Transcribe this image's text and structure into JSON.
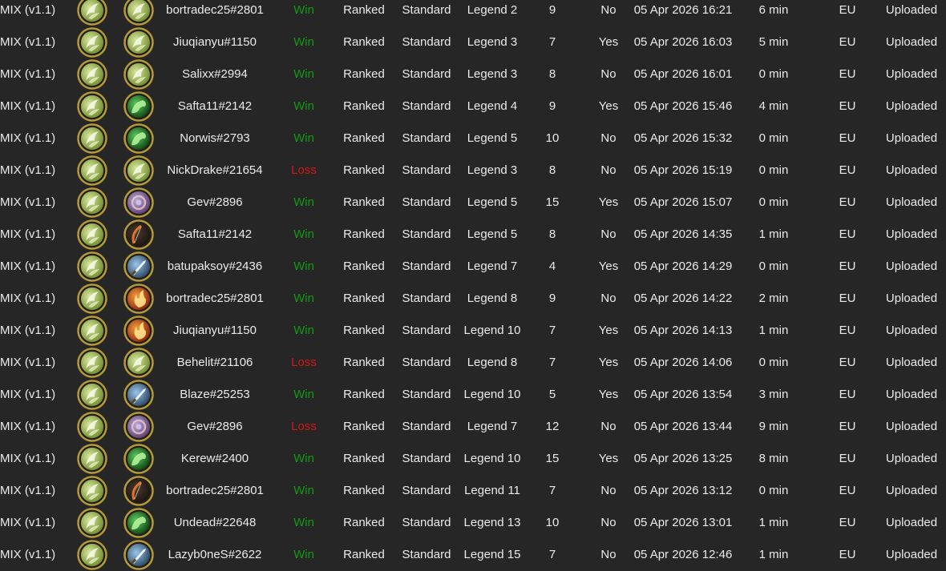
{
  "colors": {
    "background": "#262626",
    "text": "#ebebeb",
    "win": "#139613",
    "loss": "#d21717",
    "frame_gold": "#b59a3a"
  },
  "rows": [
    {
      "deck": "MIX (v1.1)",
      "player_icon": "druid-hero-icon",
      "opponent_icon": "druid-hero-icon",
      "opponent": "bortradec25#2801",
      "result": "Win",
      "mode": "Ranked",
      "format": "Standard",
      "rank": "Legend 2",
      "turns": "9",
      "coin": "No",
      "time": "05 Apr 2026 16:21",
      "duration": "6 min",
      "region": "EU",
      "status": "Uploaded"
    },
    {
      "deck": "MIX (v1.1)",
      "player_icon": "druid-hero-icon",
      "opponent_icon": "druid-hero-icon",
      "opponent": "Jiuqianyu#1150",
      "result": "Win",
      "mode": "Ranked",
      "format": "Standard",
      "rank": "Legend 3",
      "turns": "7",
      "coin": "Yes",
      "time": "05 Apr 2026 16:03",
      "duration": "5 min",
      "region": "EU",
      "status": "Uploaded"
    },
    {
      "deck": "MIX (v1.1)",
      "player_icon": "druid-hero-icon",
      "opponent_icon": "druid-hero-icon",
      "opponent": "Salixx#2994",
      "result": "Win",
      "mode": "Ranked",
      "format": "Standard",
      "rank": "Legend 3",
      "turns": "8",
      "coin": "No",
      "time": "05 Apr 2026 16:01",
      "duration": "0 min",
      "region": "EU",
      "status": "Uploaded"
    },
    {
      "deck": "MIX (v1.1)",
      "player_icon": "druid-hero-icon",
      "opponent_icon": "green-dragon-hero-icon",
      "opponent": "Safta11#2142",
      "result": "Win",
      "mode": "Ranked",
      "format": "Standard",
      "rank": "Legend 4",
      "turns": "9",
      "coin": "Yes",
      "time": "05 Apr 2026 15:46",
      "duration": "4 min",
      "region": "EU",
      "status": "Uploaded"
    },
    {
      "deck": "MIX (v1.1)",
      "player_icon": "druid-hero-icon",
      "opponent_icon": "green-dragon-hero-icon",
      "opponent": "Norwis#2793",
      "result": "Win",
      "mode": "Ranked",
      "format": "Standard",
      "rank": "Legend 5",
      "turns": "10",
      "coin": "No",
      "time": "05 Apr 2026 15:32",
      "duration": "0 min",
      "region": "EU",
      "status": "Uploaded"
    },
    {
      "deck": "MIX (v1.1)",
      "player_icon": "druid-hero-icon",
      "opponent_icon": "druid-hero-icon",
      "opponent": "NickDrake#21654",
      "result": "Loss",
      "mode": "Ranked",
      "format": "Standard",
      "rank": "Legend 3",
      "turns": "8",
      "coin": "No",
      "time": "05 Apr 2026 15:19",
      "duration": "0 min",
      "region": "EU",
      "status": "Uploaded"
    },
    {
      "deck": "MIX (v1.1)",
      "player_icon": "druid-hero-icon",
      "opponent_icon": "arcane-hero-icon",
      "opponent": "Gev#2896",
      "result": "Win",
      "mode": "Ranked",
      "format": "Standard",
      "rank": "Legend 5",
      "turns": "15",
      "coin": "Yes",
      "time": "05 Apr 2026 15:07",
      "duration": "0 min",
      "region": "EU",
      "status": "Uploaded"
    },
    {
      "deck": "MIX (v1.1)",
      "player_icon": "druid-hero-icon",
      "opponent_icon": "bow-hero-icon",
      "opponent": "Safta11#2142",
      "result": "Win",
      "mode": "Ranked",
      "format": "Standard",
      "rank": "Legend 5",
      "turns": "8",
      "coin": "No",
      "time": "05 Apr 2026 14:35",
      "duration": "1 min",
      "region": "EU",
      "status": "Uploaded"
    },
    {
      "deck": "MIX (v1.1)",
      "player_icon": "druid-hero-icon",
      "opponent_icon": "sword-hero-icon",
      "opponent": "batupaksoy#2436",
      "result": "Win",
      "mode": "Ranked",
      "format": "Standard",
      "rank": "Legend 7",
      "turns": "4",
      "coin": "Yes",
      "time": "05 Apr 2026 14:29",
      "duration": "0 min",
      "region": "EU",
      "status": "Uploaded"
    },
    {
      "deck": "MIX (v1.1)",
      "player_icon": "druid-hero-icon",
      "opponent_icon": "fire-hero-icon",
      "opponent": "bortradec25#2801",
      "result": "Win",
      "mode": "Ranked",
      "format": "Standard",
      "rank": "Legend 8",
      "turns": "9",
      "coin": "No",
      "time": "05 Apr 2026 14:22",
      "duration": "2 min",
      "region": "EU",
      "status": "Uploaded"
    },
    {
      "deck": "MIX (v1.1)",
      "player_icon": "druid-hero-icon",
      "opponent_icon": "fire-hero-icon",
      "opponent": "Jiuqianyu#1150",
      "result": "Win",
      "mode": "Ranked",
      "format": "Standard",
      "rank": "Legend 10",
      "turns": "7",
      "coin": "Yes",
      "time": "05 Apr 2026 14:13",
      "duration": "1 min",
      "region": "EU",
      "status": "Uploaded"
    },
    {
      "deck": "MIX (v1.1)",
      "player_icon": "druid-hero-icon",
      "opponent_icon": "druid-hero-icon",
      "opponent": "Behelit#21106",
      "result": "Loss",
      "mode": "Ranked",
      "format": "Standard",
      "rank": "Legend 8",
      "turns": "7",
      "coin": "Yes",
      "time": "05 Apr 2026 14:06",
      "duration": "0 min",
      "region": "EU",
      "status": "Uploaded"
    },
    {
      "deck": "MIX (v1.1)",
      "player_icon": "druid-hero-icon",
      "opponent_icon": "sword-hero-icon",
      "opponent": "Blaze#25253",
      "result": "Win",
      "mode": "Ranked",
      "format": "Standard",
      "rank": "Legend 10",
      "turns": "5",
      "coin": "Yes",
      "time": "05 Apr 2026 13:54",
      "duration": "3 min",
      "region": "EU",
      "status": "Uploaded"
    },
    {
      "deck": "MIX (v1.1)",
      "player_icon": "druid-hero-icon",
      "opponent_icon": "arcane-hero-icon",
      "opponent": "Gev#2896",
      "result": "Loss",
      "mode": "Ranked",
      "format": "Standard",
      "rank": "Legend 7",
      "turns": "12",
      "coin": "No",
      "time": "05 Apr 2026 13:44",
      "duration": "9 min",
      "region": "EU",
      "status": "Uploaded"
    },
    {
      "deck": "MIX (v1.1)",
      "player_icon": "druid-hero-icon",
      "opponent_icon": "green-dragon-hero-icon",
      "opponent": "Kerew#2400",
      "result": "Win",
      "mode": "Ranked",
      "format": "Standard",
      "rank": "Legend 10",
      "turns": "15",
      "coin": "Yes",
      "time": "05 Apr 2026 13:25",
      "duration": "8 min",
      "region": "EU",
      "status": "Uploaded"
    },
    {
      "deck": "MIX (v1.1)",
      "player_icon": "druid-hero-icon",
      "opponent_icon": "bow-hero-icon",
      "opponent": "bortradec25#2801",
      "result": "Win",
      "mode": "Ranked",
      "format": "Standard",
      "rank": "Legend 11",
      "turns": "7",
      "coin": "No",
      "time": "05 Apr 2026 13:12",
      "duration": "0 min",
      "region": "EU",
      "status": "Uploaded"
    },
    {
      "deck": "MIX (v1.1)",
      "player_icon": "druid-hero-icon",
      "opponent_icon": "green-dragon-hero-icon",
      "opponent": "Undead#22648",
      "result": "Win",
      "mode": "Ranked",
      "format": "Standard",
      "rank": "Legend 13",
      "turns": "10",
      "coin": "No",
      "time": "05 Apr 2026 13:01",
      "duration": "1 min",
      "region": "EU",
      "status": "Uploaded"
    },
    {
      "deck": "MIX (v1.1)",
      "player_icon": "druid-hero-icon",
      "opponent_icon": "sword-hero-icon",
      "opponent": "Lazyb0neS#2622",
      "result": "Win",
      "mode": "Ranked",
      "format": "Standard",
      "rank": "Legend 15",
      "turns": "7",
      "coin": "No",
      "time": "05 Apr 2026 12:46",
      "duration": "1 min",
      "region": "EU",
      "status": "Uploaded"
    }
  ]
}
